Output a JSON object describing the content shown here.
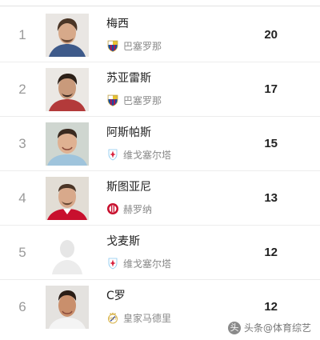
{
  "players": [
    {
      "rank": "1",
      "name": "梅西",
      "club": "巴塞罗那",
      "club_badge": "barcelona-badge-icon",
      "goals": "20",
      "photo": "player-photo"
    },
    {
      "rank": "2",
      "name": "苏亚雷斯",
      "club": "巴塞罗那",
      "club_badge": "barcelona-badge-icon",
      "goals": "17",
      "photo": "player-photo"
    },
    {
      "rank": "3",
      "name": "阿斯帕斯",
      "club": "维戈塞尔塔",
      "club_badge": "celta-vigo-badge-icon",
      "goals": "15",
      "photo": "player-photo"
    },
    {
      "rank": "4",
      "name": "斯图亚尼",
      "club": "赫罗纳",
      "club_badge": "girona-badge-icon",
      "goals": "13",
      "photo": "player-photo"
    },
    {
      "rank": "5",
      "name": "戈麦斯",
      "club": "维戈塞尔塔",
      "club_badge": "celta-vigo-badge-icon",
      "goals": "12",
      "photo": "placeholder-avatar"
    },
    {
      "rank": "6",
      "name": "C罗",
      "club": "皇家马德里",
      "club_badge": "real-madrid-badge-icon",
      "goals": "12",
      "photo": "player-photo"
    }
  ],
  "watermark": {
    "icon": "头",
    "text": "头条@体育综艺"
  },
  "colors": {
    "barcelona_blue": "#1c4aa0",
    "barcelona_red": "#b5154b",
    "celta_blue": "#87c7ef",
    "celta_red": "#d8223f",
    "girona_red": "#c8102e",
    "madrid_gold": "#d9b44a"
  }
}
